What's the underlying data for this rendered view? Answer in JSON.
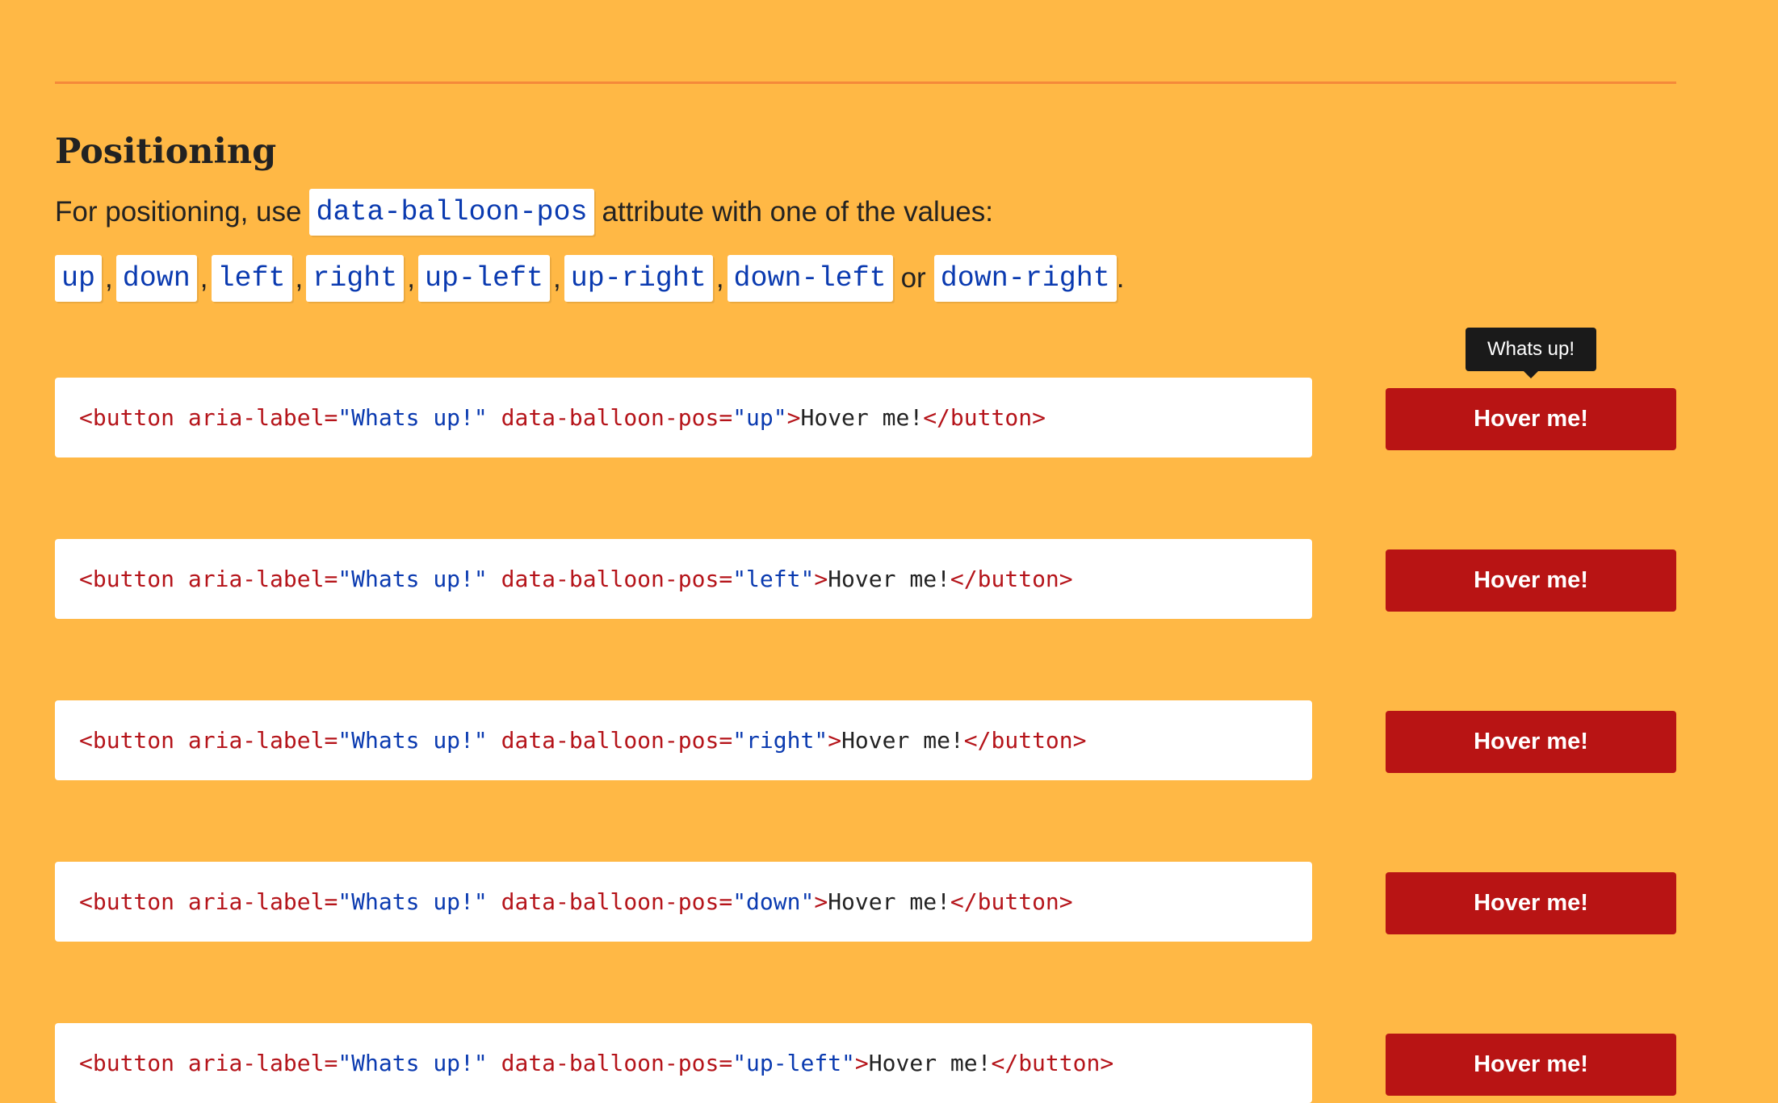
{
  "section": {
    "title": "Positioning",
    "intro_before": "For positioning, use",
    "intro_code": "data-balloon-pos",
    "intro_after": "attribute with one of the values:",
    "values": [
      "up",
      "down",
      "left",
      "right",
      "up-left",
      "up-right",
      "down-left",
      "down-right"
    ],
    "value_separator": ",",
    "value_or": "or",
    "value_end": "."
  },
  "examples": [
    {
      "code": {
        "open": "<button",
        "attr1": "aria-label=",
        "val1": "\"Whats up!\"",
        "attr2": "data-balloon-pos=",
        "val2": "\"up\"",
        "close_open": ">",
        "text": "Hover me!",
        "end_tag": "</button>"
      },
      "button_label": "Hover me!"
    },
    {
      "code": {
        "open": "<button",
        "attr1": "aria-label=",
        "val1": "\"Whats up!\"",
        "attr2": "data-balloon-pos=",
        "val2": "\"left\"",
        "close_open": ">",
        "text": "Hover me!",
        "end_tag": "</button>"
      },
      "button_label": "Hover me!"
    },
    {
      "code": {
        "open": "<button",
        "attr1": "aria-label=",
        "val1": "\"Whats up!\"",
        "attr2": "data-balloon-pos=",
        "val2": "\"right\"",
        "close_open": ">",
        "text": "Hover me!",
        "end_tag": "</button>"
      },
      "button_label": "Hover me!"
    },
    {
      "code": {
        "open": "<button",
        "attr1": "aria-label=",
        "val1": "\"Whats up!\"",
        "attr2": "data-balloon-pos=",
        "val2": "\"down\"",
        "close_open": ">",
        "text": "Hover me!",
        "end_tag": "</button>"
      },
      "button_label": "Hover me!"
    },
    {
      "code": {
        "open": "<button",
        "attr1": "aria-label=",
        "val1": "\"Whats up!\"",
        "attr2": "data-balloon-pos=",
        "val2": "\"up-left\"",
        "close_open": ">",
        "text": "Hover me!",
        "end_tag": "</button>"
      },
      "button_label": "Hover me!"
    }
  ],
  "tooltip": {
    "text": "Whats up!"
  },
  "colors": {
    "background": "#ffb845",
    "divider": "#f5893a",
    "button": "#b81414",
    "code_tag": "#b5141a",
    "code_string": "#0a3ab0",
    "tooltip": "#1a1a1a"
  }
}
